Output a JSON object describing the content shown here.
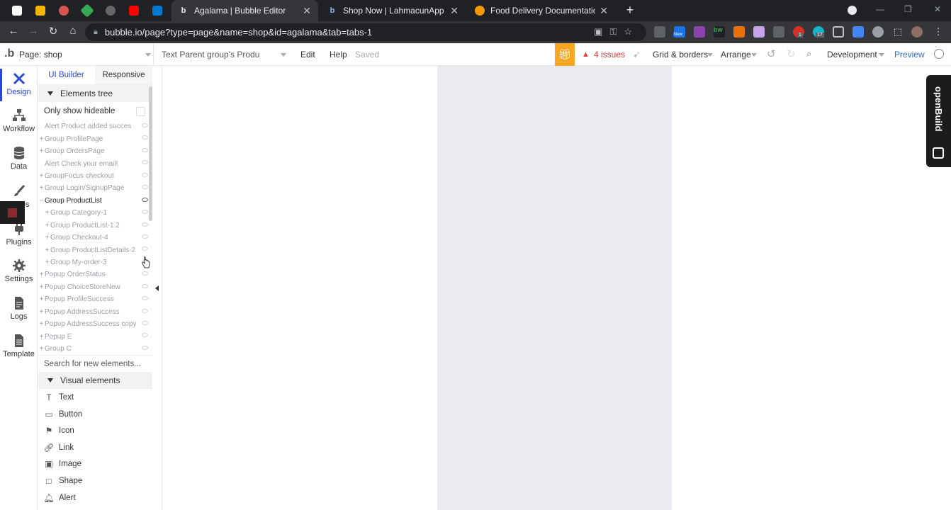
{
  "browser": {
    "tabs": [
      {
        "title": "Agalama | Bubble Editor",
        "active": true
      },
      {
        "title": "Shop Now | LahmacunApp",
        "active": false
      },
      {
        "title": "Food Delivery Documentation",
        "active": false
      }
    ],
    "url": "bubble.io/page?type=page&name=shop&id=agalama&tab=tabs-1",
    "ext_badges": {
      "new": "New",
      "one": "1",
      "seventeen": "17"
    }
  },
  "topbar": {
    "page_label": "Page: shop",
    "element_selector": "Text Parent group's Produ",
    "edit": "Edit",
    "help": "Help",
    "saved": "Saved",
    "issues": "4 issues",
    "grid": "Grid & borders",
    "arrange": "Arrange",
    "environment": "Development",
    "preview": "Preview"
  },
  "rail": {
    "design": "Design",
    "workflow": "Workflow",
    "data": "Data",
    "styles": "Styles",
    "plugins": "Plugins",
    "settings": "Settings",
    "logs": "Logs",
    "template": "Template"
  },
  "panel": {
    "tab_ui": "UI Builder",
    "tab_responsive": "Responsive",
    "elements_tree": "Elements tree",
    "only_show": "Only show hideable",
    "tree": [
      {
        "label": "Alert Product added succes",
        "pm": "",
        "indent": 0,
        "hl": false
      },
      {
        "label": "Group ProfilePage",
        "pm": "+",
        "indent": 0,
        "hl": false
      },
      {
        "label": "Group OrdersPage",
        "pm": "+",
        "indent": 0,
        "hl": false
      },
      {
        "label": "Alert Check your email!",
        "pm": "",
        "indent": 0,
        "hl": false
      },
      {
        "label": "GroupFocus checkout",
        "pm": "+",
        "indent": 0,
        "hl": false
      },
      {
        "label": "Group Login/SignupPage",
        "pm": "+",
        "indent": 0,
        "hl": false
      },
      {
        "label": "Group ProductList",
        "pm": "−",
        "indent": 0,
        "hl": true
      },
      {
        "label": "Group Category-1",
        "pm": "+",
        "indent": 1,
        "hl": false
      },
      {
        "label": "Group ProductList-1.2",
        "pm": "+",
        "indent": 1,
        "hl": false
      },
      {
        "label": "Group Checkout-4",
        "pm": "+",
        "indent": 1,
        "hl": false
      },
      {
        "label": "Group ProductListDetails-2",
        "pm": "+",
        "indent": 1,
        "hl": false
      },
      {
        "label": "Group My-order-3",
        "pm": "+",
        "indent": 1,
        "hl": false
      },
      {
        "label": "Popup OrderStatus",
        "pm": "+",
        "indent": 0,
        "hl": false
      },
      {
        "label": "Popup ChoiceStoreNew",
        "pm": "+",
        "indent": 0,
        "hl": false
      },
      {
        "label": "Popup ProfileSuccess",
        "pm": "+",
        "indent": 0,
        "hl": false
      },
      {
        "label": "Popup AddressSuccess",
        "pm": "+",
        "indent": 0,
        "hl": false
      },
      {
        "label": "Popup AddressSuccess copy",
        "pm": "+",
        "indent": 0,
        "hl": false
      },
      {
        "label": "Popup E",
        "pm": "+",
        "indent": 0,
        "hl": false
      },
      {
        "label": "Group C",
        "pm": "+",
        "indent": 0,
        "hl": false
      }
    ],
    "search_placeholder": "Search for new elements...",
    "visual_elements": "Visual elements",
    "visual": [
      {
        "label": "Text",
        "icon": "text-icon"
      },
      {
        "label": "Button",
        "icon": "button-icon"
      },
      {
        "label": "Icon",
        "icon": "flag-icon"
      },
      {
        "label": "Link",
        "icon": "link-icon"
      },
      {
        "label": "Image",
        "icon": "image-icon"
      },
      {
        "label": "Shape",
        "icon": "shape-icon"
      },
      {
        "label": "Alert",
        "icon": "bell-icon"
      }
    ]
  },
  "openbuild": {
    "label": "openBuild"
  }
}
